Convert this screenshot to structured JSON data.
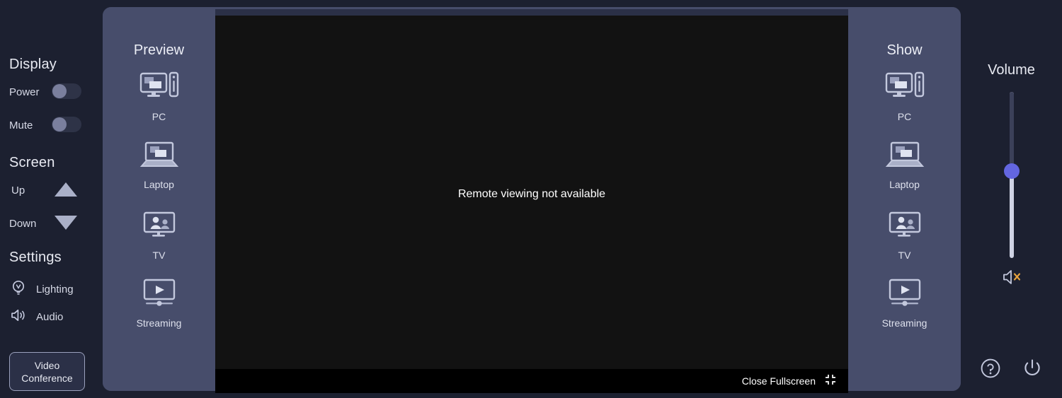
{
  "left_sidebar": {
    "display": {
      "title": "Display",
      "rows": [
        {
          "label": "Power",
          "state": "off"
        },
        {
          "label": "Mute",
          "state": "off"
        }
      ]
    },
    "screen": {
      "title": "Screen",
      "rows": [
        {
          "label": "Up",
          "icon": "triangle-up-icon"
        },
        {
          "label": "Down",
          "icon": "triangle-down-icon"
        }
      ]
    },
    "settings": {
      "title": "Settings",
      "items": [
        {
          "label": "Lighting",
          "icon": "lightbulb-icon"
        },
        {
          "label": "Audio",
          "icon": "speaker-icon"
        }
      ]
    },
    "video_conference_button": "Video\nConference",
    "video_conference_line1": "Video",
    "video_conference_line2": "Conference"
  },
  "preview_panel": {
    "title": "Preview",
    "sources": [
      {
        "label": "PC",
        "icon": "desktop-pc-icon"
      },
      {
        "label": "Laptop",
        "icon": "laptop-icon"
      },
      {
        "label": "TV",
        "icon": "tv-people-icon"
      },
      {
        "label": "Streaming",
        "icon": "media-play-icon"
      }
    ]
  },
  "show_panel": {
    "title": "Show",
    "sources": [
      {
        "label": "PC",
        "icon": "desktop-pc-icon"
      },
      {
        "label": "Laptop",
        "icon": "laptop-icon"
      },
      {
        "label": "TV",
        "icon": "tv-people-icon"
      },
      {
        "label": "Streaming",
        "icon": "media-play-icon"
      }
    ]
  },
  "video_area": {
    "message": "Remote viewing not available",
    "close_fullscreen_label": "Close Fullscreen",
    "close_fullscreen_icon": "exit-fullscreen-icon"
  },
  "volume_panel": {
    "title": "Volume",
    "level_percent": 44,
    "mute_icon": "speaker-muted-icon",
    "help_icon": "help-circle-icon",
    "power_icon": "power-icon"
  },
  "colors": {
    "page_bg": "#1c2030",
    "panel_bg": "#474d6b",
    "video_bg": "#121212",
    "slider_accent": "#6366e0",
    "mute_x": "#e8a33d",
    "icon_fill": "#c3c8dd",
    "text_primary": "#e8eaf2"
  }
}
